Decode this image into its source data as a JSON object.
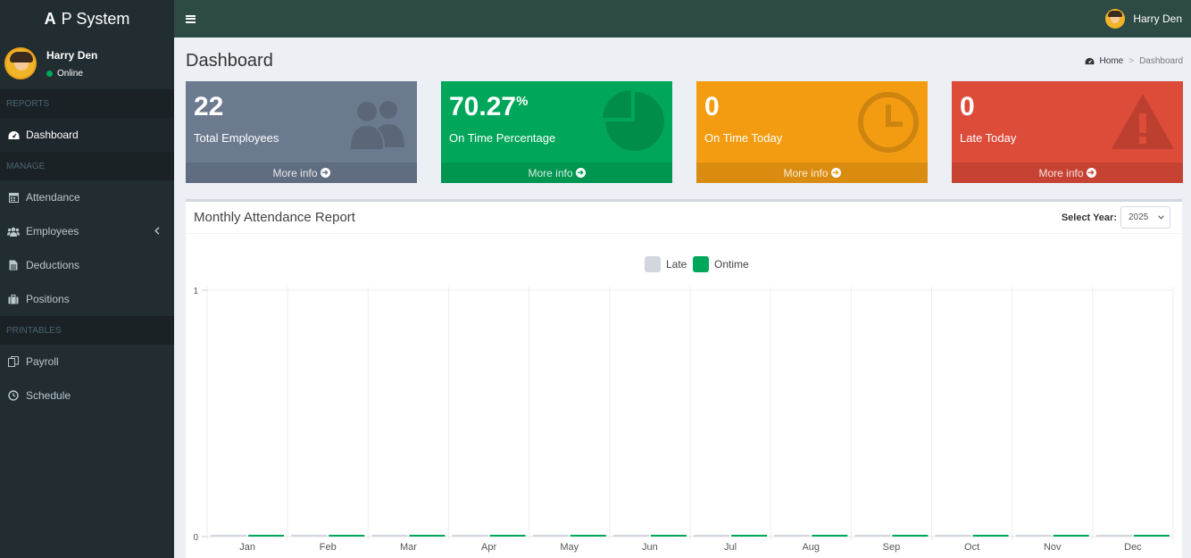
{
  "app": {
    "logo_strong": "A",
    "logo_rest": "P System"
  },
  "user": {
    "name": "Harry Den",
    "status": "Online"
  },
  "sidebar": {
    "sections": [
      {
        "header": "REPORTS",
        "items": [
          {
            "label": "Dashboard",
            "icon": "dashboard-icon",
            "active": true
          }
        ]
      },
      {
        "header": "MANAGE",
        "items": [
          {
            "label": "Attendance",
            "icon": "calendar-icon"
          },
          {
            "label": "Employees",
            "icon": "users-icon",
            "expandable": true
          },
          {
            "label": "Deductions",
            "icon": "file-icon"
          },
          {
            "label": "Positions",
            "icon": "briefcase-icon"
          }
        ]
      },
      {
        "header": "PRINTABLES",
        "items": [
          {
            "label": "Payroll",
            "icon": "files-icon"
          },
          {
            "label": "Schedule",
            "icon": "clock-icon"
          }
        ]
      }
    ]
  },
  "topbar": {
    "menu_icon": "hamburger-icon",
    "user_name": "Harry Den"
  },
  "page": {
    "title": "Dashboard",
    "breadcrumb_home": "Home",
    "breadcrumb_current": "Dashboard"
  },
  "stats": [
    {
      "value": "22",
      "suffix": "",
      "label": "Total Employees",
      "more": "More info",
      "color": "#6b7a8f",
      "icon": "users-icon"
    },
    {
      "value": "70.27",
      "suffix": "%",
      "label": "On Time Percentage",
      "more": "More info",
      "color": "#00a65a",
      "icon": "pie-chart-icon"
    },
    {
      "value": "0",
      "suffix": "",
      "label": "On Time Today",
      "more": "More info",
      "color": "#f39c12",
      "icon": "clock-icon"
    },
    {
      "value": "0",
      "suffix": "",
      "label": "Late Today",
      "more": "More info",
      "color": "#dd4b39",
      "icon": "warning-icon"
    }
  ],
  "report": {
    "title": "Monthly Attendance Report",
    "select_label": "Select Year:",
    "year": "2025"
  },
  "chart_data": {
    "type": "bar",
    "title": "",
    "categories": [
      "Jan",
      "Feb",
      "Mar",
      "Apr",
      "May",
      "Jun",
      "Jul",
      "Aug",
      "Sep",
      "Oct",
      "Nov",
      "Dec"
    ],
    "series": [
      {
        "name": "Late",
        "color": "#d2d6de",
        "values": [
          0,
          0,
          0,
          0,
          0,
          0,
          0,
          0,
          0,
          0,
          0,
          0
        ]
      },
      {
        "name": "Ontime",
        "color": "#00a65a",
        "values": [
          0,
          0,
          0,
          0,
          0,
          0,
          0,
          0,
          0,
          0,
          0,
          0
        ]
      }
    ],
    "ylim": [
      0,
      1
    ],
    "yticks": [
      "1",
      "0"
    ],
    "legend": "top-center",
    "grid": true
  }
}
